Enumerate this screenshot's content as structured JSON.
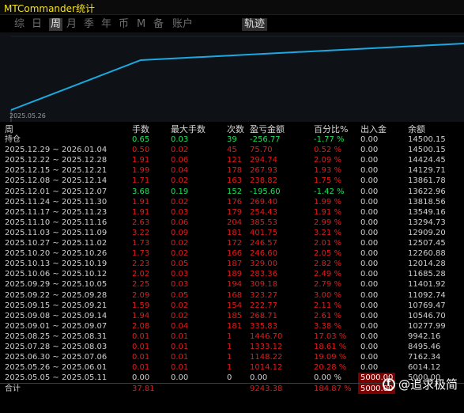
{
  "app_title": "MTCommander统计",
  "tabs": [
    {
      "label": "综"
    },
    {
      "label": "日"
    },
    {
      "label": "周"
    },
    {
      "label": "月"
    },
    {
      "label": "季"
    },
    {
      "label": "年"
    },
    {
      "label": "币"
    },
    {
      "label": "M"
    },
    {
      "label": "备"
    },
    {
      "label": "账户"
    },
    {
      "label": "轨迹"
    }
  ],
  "active_tab": "周",
  "chart": {
    "start_date": "2025.05.26",
    "line_color": "#1aa9e0"
  },
  "headers": [
    "周",
    "手数",
    "最大手数",
    "次数",
    "盈亏金额",
    "百分比%",
    "出入金",
    "余额"
  ],
  "holding": {
    "label": "持仓",
    "lots": "0.65",
    "max_lots": "0.03",
    "count": "39",
    "pnl": "-256.77",
    "pct": "-1.77 %",
    "inout": "0.00",
    "balance": "14500.15"
  },
  "rows": [
    {
      "week": "2025.12.29 ~ 2026.01.04",
      "lots": "0.50",
      "max_lots": "0.02",
      "count": "45",
      "pnl": "75.70",
      "pct": "0.52 %",
      "inout": "0.00",
      "balance": "14500.15",
      "color": "red"
    },
    {
      "week": "2025.12.22 ~ 2025.12.28",
      "lots": "1.91",
      "max_lots": "0.06",
      "count": "121",
      "pnl": "294.74",
      "pct": "2.09 %",
      "inout": "0.00",
      "balance": "14424.45",
      "color": "red"
    },
    {
      "week": "2025.12.15 ~ 2025.12.21",
      "lots": "1.99",
      "max_lots": "0.04",
      "count": "178",
      "pnl": "267.93",
      "pct": "1.93 %",
      "inout": "0.00",
      "balance": "14129.71",
      "color": "red"
    },
    {
      "week": "2025.12.08 ~ 2025.12.14",
      "lots": "1.71",
      "max_lots": "0.02",
      "count": "163",
      "pnl": "238.82",
      "pct": "1.75 %",
      "inout": "0.00",
      "balance": "13861.78",
      "color": "red"
    },
    {
      "week": "2025.12.01 ~ 2025.12.07",
      "lots": "3.68",
      "max_lots": "0.19",
      "count": "152",
      "pnl": "-195.60",
      "pct": "-1.42 %",
      "inout": "0.00",
      "balance": "13622.96",
      "color": "green"
    },
    {
      "week": "2025.11.24 ~ 2025.11.30",
      "lots": "1.91",
      "max_lots": "0.02",
      "count": "176",
      "pnl": "269.40",
      "pct": "1.99 %",
      "inout": "0.00",
      "balance": "13818.56",
      "color": "red"
    },
    {
      "week": "2025.11.17 ~ 2025.11.23",
      "lots": "1.91",
      "max_lots": "0.03",
      "count": "179",
      "pnl": "254.43",
      "pct": "1.91 %",
      "inout": "0.00",
      "balance": "13549.16",
      "color": "red"
    },
    {
      "week": "2025.11.10 ~ 2025.11.16",
      "lots": "2.63",
      "max_lots": "0.06",
      "count": "204",
      "pnl": "385.53",
      "pct": "2.99 %",
      "inout": "0.00",
      "balance": "13294.73",
      "color": "red"
    },
    {
      "week": "2025.11.03 ~ 2025.11.09",
      "lots": "3.22",
      "max_lots": "0.09",
      "count": "181",
      "pnl": "401.75",
      "pct": "3.21 %",
      "inout": "0.00",
      "balance": "12909.20",
      "color": "red"
    },
    {
      "week": "2025.10.27 ~ 2025.11.02",
      "lots": "1.73",
      "max_lots": "0.02",
      "count": "172",
      "pnl": "246.57",
      "pct": "2.01 %",
      "inout": "0.00",
      "balance": "12507.45",
      "color": "red"
    },
    {
      "week": "2025.10.20 ~ 2025.10.26",
      "lots": "1.73",
      "max_lots": "0.02",
      "count": "166",
      "pnl": "246.60",
      "pct": "2.05 %",
      "inout": "0.00",
      "balance": "12260.88",
      "color": "red"
    },
    {
      "week": "2025.10.13 ~ 2025.10.19",
      "lots": "2.23",
      "max_lots": "0.05",
      "count": "187",
      "pnl": "329.00",
      "pct": "2.82 %",
      "inout": "0.00",
      "balance": "12014.28",
      "color": "red"
    },
    {
      "week": "2025.10.06 ~ 2025.10.12",
      "lots": "2.02",
      "max_lots": "0.03",
      "count": "189",
      "pnl": "283.36",
      "pct": "2.49 %",
      "inout": "0.00",
      "balance": "11685.28",
      "color": "red"
    },
    {
      "week": "2025.09.29 ~ 2025.10.05",
      "lots": "2.25",
      "max_lots": "0.03",
      "count": "194",
      "pnl": "309.18",
      "pct": "2.79 %",
      "inout": "0.00",
      "balance": "11401.92",
      "color": "red"
    },
    {
      "week": "2025.09.22 ~ 2025.09.28",
      "lots": "2.09",
      "max_lots": "0.05",
      "count": "168",
      "pnl": "323.27",
      "pct": "3.00 %",
      "inout": "0.00",
      "balance": "11092.74",
      "color": "red"
    },
    {
      "week": "2025.09.15 ~ 2025.09.21",
      "lots": "1.59",
      "max_lots": "0.02",
      "count": "154",
      "pnl": "222.77",
      "pct": "2.11 %",
      "inout": "0.00",
      "balance": "10769.47",
      "color": "red"
    },
    {
      "week": "2025.09.08 ~ 2025.09.14",
      "lots": "1.94",
      "max_lots": "0.02",
      "count": "185",
      "pnl": "268.71",
      "pct": "2.61 %",
      "inout": "0.00",
      "balance": "10546.70",
      "color": "red"
    },
    {
      "week": "2025.09.01 ~ 2025.09.07",
      "lots": "2.08",
      "max_lots": "0.04",
      "count": "181",
      "pnl": "335.83",
      "pct": "3.38 %",
      "inout": "0.00",
      "balance": "10277.99",
      "color": "red"
    },
    {
      "week": "2025.08.25 ~ 2025.08.31",
      "lots": "0.01",
      "max_lots": "0.01",
      "count": "1",
      "pnl": "1446.70",
      "pct": "17.03 %",
      "inout": "0.00",
      "balance": "9942.16",
      "color": "red"
    },
    {
      "week": "2025.07.28 ~ 2025.08.03",
      "lots": "0.01",
      "max_lots": "0.01",
      "count": "1",
      "pnl": "1333.12",
      "pct": "18.61 %",
      "inout": "0.00",
      "balance": "8495.46",
      "color": "red"
    },
    {
      "week": "2025.06.30 ~ 2025.07.06",
      "lots": "0.01",
      "max_lots": "0.01",
      "count": "1",
      "pnl": "1148.22",
      "pct": "19.09 %",
      "inout": "0.00",
      "balance": "7162.34",
      "color": "red"
    },
    {
      "week": "2025.05.26 ~ 2025.06.01",
      "lots": "0.01",
      "max_lots": "0.01",
      "count": "1",
      "pnl": "1014.12",
      "pct": "20.28 %",
      "inout": "0.00",
      "balance": "6014.12",
      "color": "red"
    },
    {
      "week": "2025.05.05 ~ 2025.05.11",
      "lots": "0.00",
      "max_lots": "0.00",
      "count": "0",
      "pnl": "0.00",
      "pct": "0.00 %",
      "inout": "5000.00",
      "balance": "5000.00",
      "color": "gray"
    }
  ],
  "total": {
    "label": "合计",
    "lots": "37.81",
    "pnl": "9243.38",
    "pct": "184.87 %",
    "inout": "5000.00"
  },
  "watermark": "@追求极简"
}
